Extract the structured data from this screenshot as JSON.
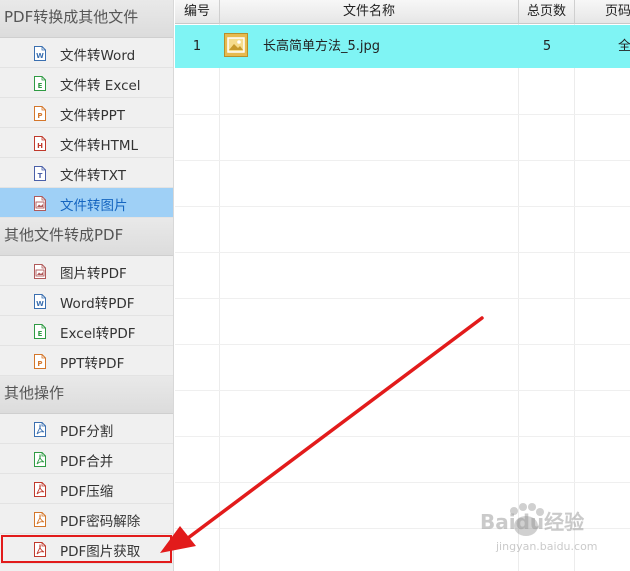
{
  "sidebar": {
    "sections": [
      {
        "title": "PDF转换成其他文件",
        "items": [
          {
            "label": "文件转Word",
            "icon": "word-file-icon",
            "color": "#3a6fb0"
          },
          {
            "label": "文件转 Excel",
            "icon": "excel-file-icon",
            "color": "#2f9a43"
          },
          {
            "label": "文件转PPT",
            "icon": "ppt-file-icon",
            "color": "#d4762a"
          },
          {
            "label": "文件转HTML",
            "icon": "html-file-icon",
            "color": "#c0392b"
          },
          {
            "label": "文件转TXT",
            "icon": "txt-file-icon",
            "color": "#4a5fa8"
          },
          {
            "label": "文件转图片",
            "icon": "image-file-icon",
            "color": "#b05a5a",
            "selected": true
          }
        ]
      },
      {
        "title": "其他文件转成PDF",
        "items": [
          {
            "label": "图片转PDF",
            "icon": "image-file-icon",
            "color": "#b05a5a"
          },
          {
            "label": "Word转PDF",
            "icon": "word-file-icon",
            "color": "#3a6fb0"
          },
          {
            "label": "Excel转PDF",
            "icon": "excel-file-icon",
            "color": "#2f9a43"
          },
          {
            "label": "PPT转PDF",
            "icon": "ppt-file-icon",
            "color": "#d4762a"
          }
        ]
      },
      {
        "title": "其他操作",
        "items": [
          {
            "label": "PDF分割",
            "icon": "pdf-file-icon",
            "color": "#3a6fb0"
          },
          {
            "label": "PDF合并",
            "icon": "pdf-file-icon",
            "color": "#2f9a43"
          },
          {
            "label": "PDF压缩",
            "icon": "pdf-file-icon",
            "color": "#c0392b"
          },
          {
            "label": "PDF密码解除",
            "icon": "pdf-file-icon",
            "color": "#d4762a"
          },
          {
            "label": "PDF图片获取",
            "icon": "pdf-file-icon",
            "color": "#c0392b",
            "highlighted": true
          }
        ]
      }
    ]
  },
  "table": {
    "columns": [
      "编号",
      "文件名称",
      "总页数",
      "页码"
    ],
    "rows": [
      {
        "no": "1",
        "filename": "长高简单方法_5.jpg",
        "pages": "5",
        "range": "全"
      }
    ]
  },
  "colors": {
    "selected_row": "#7ff4f4",
    "selected_item": "#9fd0f6",
    "annotation": "#e21b1b"
  },
  "watermark": {
    "text": "Baidu经验",
    "url": "jingyan.baidu.com"
  }
}
